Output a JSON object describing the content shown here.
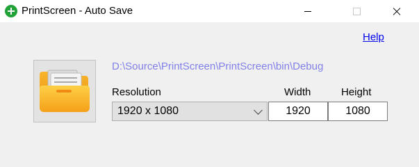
{
  "window": {
    "title": "PrintScreen - Auto Save",
    "app_icon": "add-icon",
    "controls": [
      "minimize-icon",
      "maximize-icon",
      "close-icon"
    ]
  },
  "help": {
    "label": "Help"
  },
  "folder": {
    "icon": "folder-documents-icon",
    "path": "D:\\Source\\PrintScreen\\PrintScreen\\bin\\Debug"
  },
  "resolution": {
    "label": "Resolution",
    "selected": "1920 x 1080"
  },
  "width": {
    "label": "Width",
    "value": "1920"
  },
  "height": {
    "label": "Height",
    "value": "1080"
  },
  "colors": {
    "path_text": "#8080e8",
    "link": "#0000ee",
    "folder_orange": "#f7a81c",
    "app_icon_green": "#21a339"
  }
}
